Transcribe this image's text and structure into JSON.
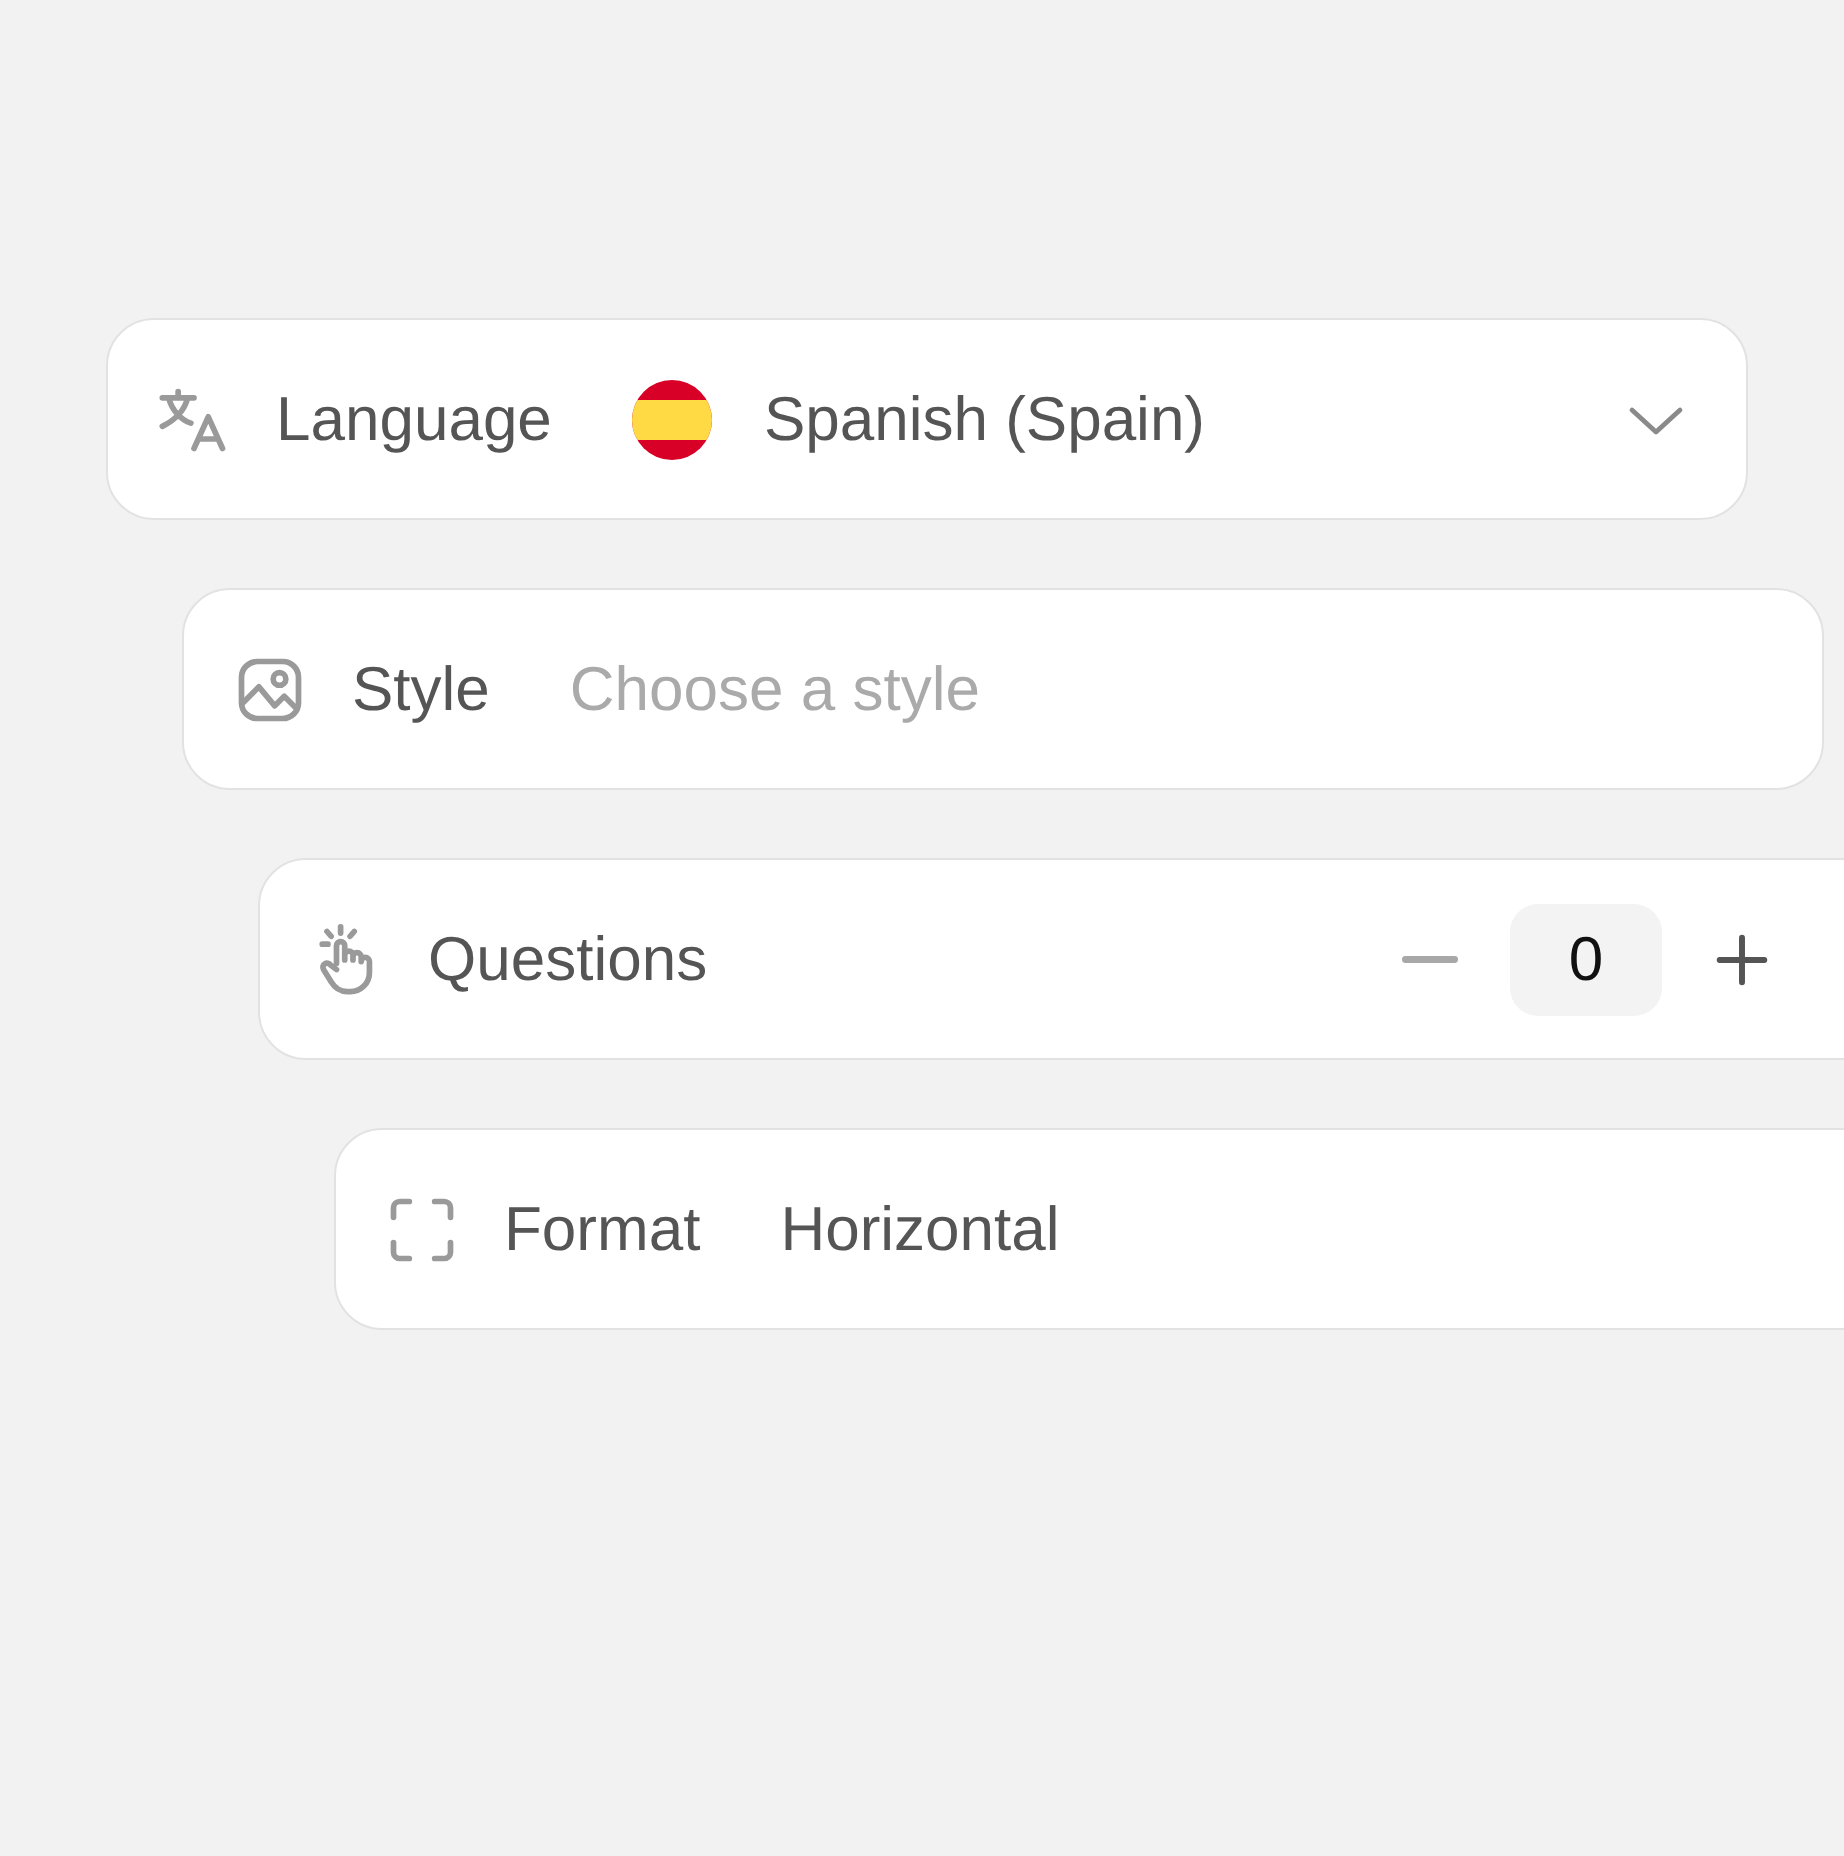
{
  "fields": [
    {
      "kind": "flag-select",
      "label": "Language",
      "value": "Spanish (Spain)"
    },
    {
      "kind": "text",
      "label": "Style",
      "placeholder": "Choose a style"
    },
    {
      "kind": "stepper",
      "label": "Questions",
      "value": "0",
      "decrement_disabled": true
    },
    {
      "kind": "select",
      "label": "Format",
      "value": "Horizontal"
    }
  ]
}
